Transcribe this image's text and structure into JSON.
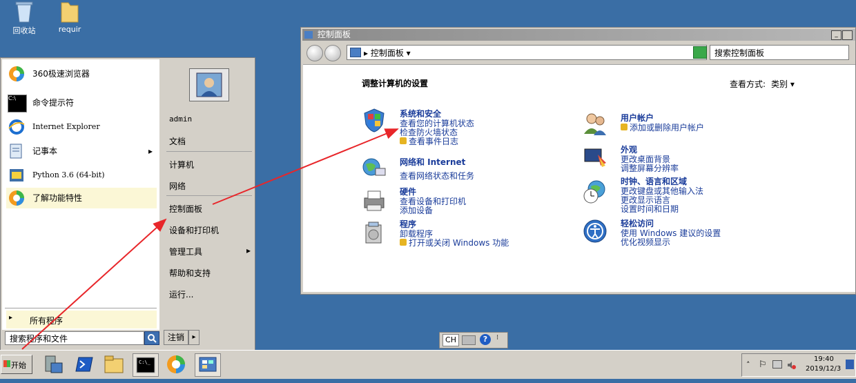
{
  "desktop": {
    "icons": [
      {
        "label": "回收站"
      },
      {
        "label": "requir"
      }
    ]
  },
  "control_panel": {
    "title": "控制面板",
    "address": "▸ 控制面板 ▾",
    "search_placeholder": "搜索控制面板",
    "heading": "调整计算机的设置",
    "view_by_label": "查看方式:",
    "view_by_value": "类别 ▾",
    "categories_left": [
      {
        "title": "系统和安全",
        "links": [
          "查看您的计算机状态",
          "检查防火墙状态",
          "查看事件日志"
        ]
      },
      {
        "title": "网络和 Internet",
        "links": [
          "查看网络状态和任务"
        ]
      },
      {
        "title": "硬件",
        "links": [
          "查看设备和打印机",
          "添加设备"
        ]
      },
      {
        "title": "程序",
        "links": [
          "卸载程序",
          "打开或关闭 Windows 功能"
        ]
      }
    ],
    "categories_right": [
      {
        "title": "用户帐户",
        "links": [
          "添加或删除用户帐户"
        ]
      },
      {
        "title": "外观",
        "links": [
          "更改桌面背景",
          "调整屏幕分辨率"
        ]
      },
      {
        "title": "时钟、语言和区域",
        "links": [
          "更改键盘或其他输入法",
          "更改显示语言",
          "设置时间和日期"
        ]
      },
      {
        "title": "轻松访问",
        "links": [
          "使用 Windows 建议的设置",
          "优化视频显示"
        ]
      }
    ]
  },
  "start_menu": {
    "programs": [
      {
        "label": "360极速浏览器"
      },
      {
        "label": "命令提示符"
      },
      {
        "label": "Internet Explorer"
      },
      {
        "label": "记事本",
        "arrow": "▸"
      },
      {
        "label": "Python 3.6 (64-bit)"
      },
      {
        "label": "了解功能特性"
      }
    ],
    "all_programs": "所有程序",
    "search_placeholder": "搜索程序和文件",
    "right_items": [
      "admin",
      "文档",
      "计算机",
      "网络",
      "控制面板",
      "设备和打印机",
      "管理工具",
      "帮助和支持",
      "运行..."
    ],
    "arrow": "▸",
    "logoff": "注销"
  },
  "taskbar": {
    "start_label": "开始",
    "language": "CH",
    "time": "19:40",
    "date": "2019/12/3",
    "tray_caret": "˄"
  }
}
